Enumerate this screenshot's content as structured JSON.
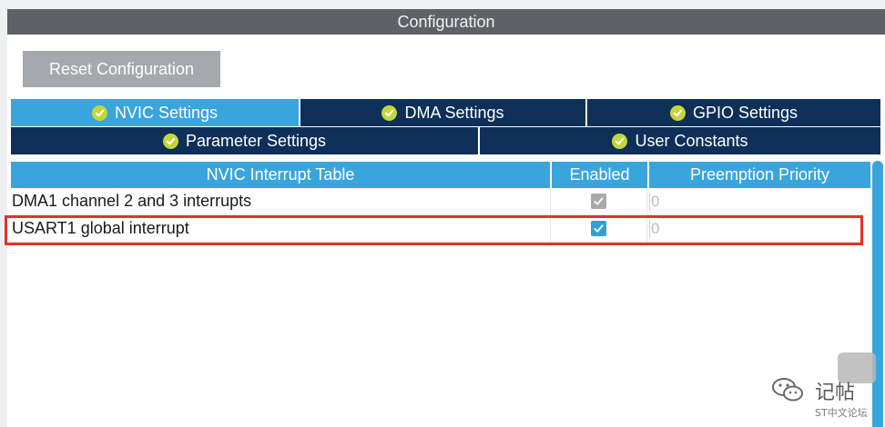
{
  "header": {
    "title": "Configuration"
  },
  "toolbar": {
    "reset_label": "Reset Configuration"
  },
  "tabs": {
    "row1": [
      {
        "label": "NVIC Settings",
        "active": true
      },
      {
        "label": "DMA Settings",
        "active": false
      },
      {
        "label": "GPIO Settings",
        "active": false
      }
    ],
    "row2": [
      {
        "label": "Parameter Settings",
        "active": false
      },
      {
        "label": "User Constants",
        "active": false
      }
    ]
  },
  "table": {
    "columns": [
      "NVIC Interrupt Table",
      "Enabled",
      "Preemption Priority"
    ],
    "rows": [
      {
        "name": "DMA1 channel 2 and 3 interrupts",
        "enabled": true,
        "editable": false,
        "priority": "0"
      },
      {
        "name": "USART1 global interrupt",
        "enabled": true,
        "editable": true,
        "priority": "0"
      }
    ]
  },
  "watermark": {
    "text": "记帖",
    "sub": "ST中文论坛"
  },
  "colors": {
    "titlebar": "#5e6266",
    "tab_active": "#3aa5dd",
    "tab_inactive": "#0e2f57",
    "check_badge": "#c3d73a",
    "highlight": "#e8302a"
  },
  "icons": {
    "tab_status": "check-circle-icon",
    "enabled": "checkbox-icon"
  }
}
